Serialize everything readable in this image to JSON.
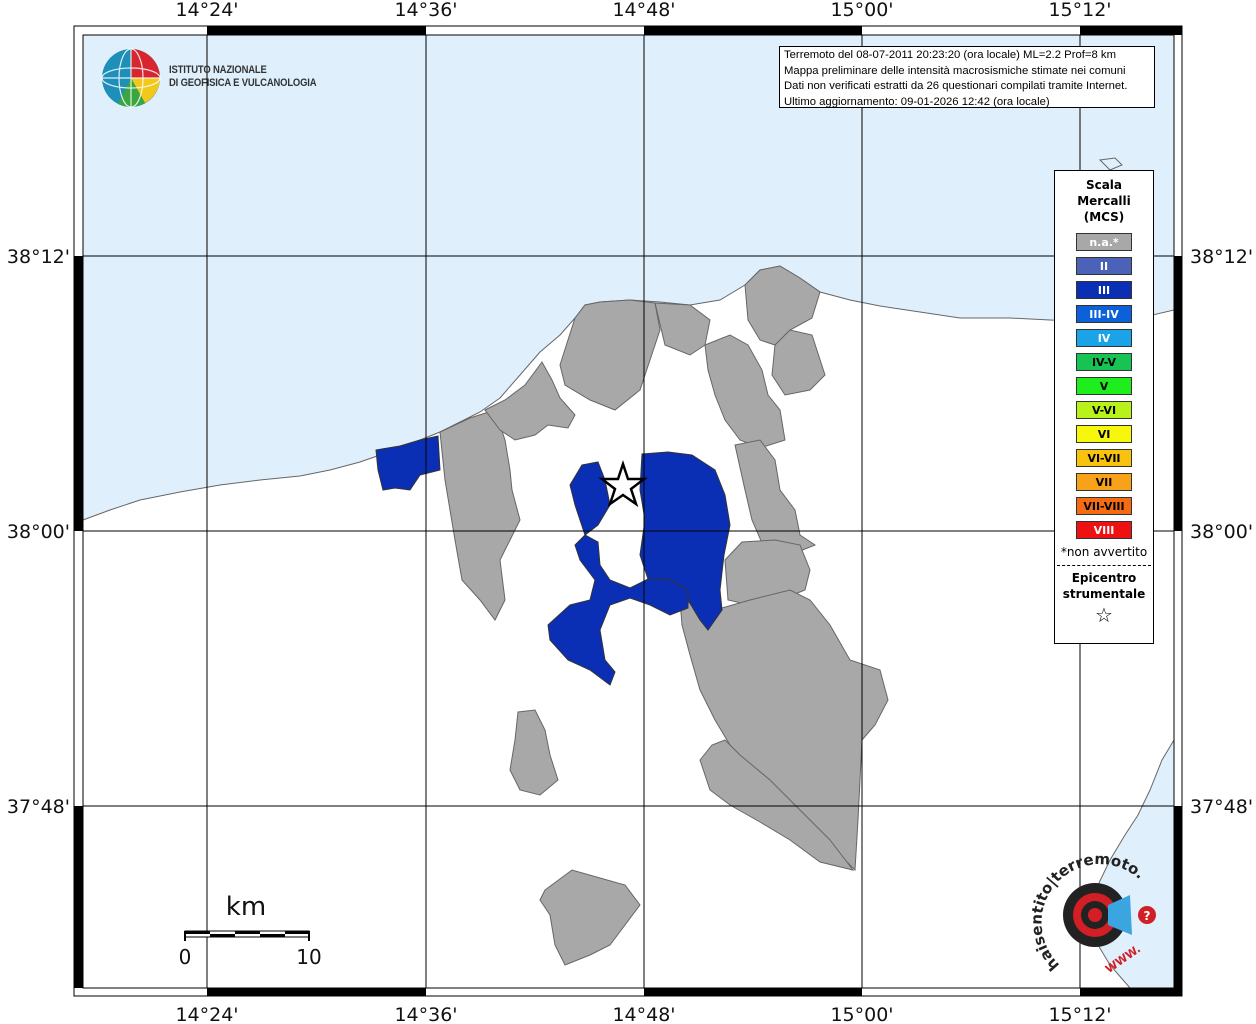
{
  "info": {
    "line1": "Terremoto del 08-07-2011 20:23:20 (ora locale) ML=2.2 Prof=8 km",
    "line2": "Mappa preliminare delle intensità macrosismiche stimate nei comuni",
    "line3": "Dati non verificati estratti da 26 questionari compilati tramite Internet.",
    "line4": "Ultimo aggiornamento: 09-01-2026 12:42 (ora locale)"
  },
  "logo": {
    "line1": "ISTITUTO NAZIONALE",
    "line2": "DI GEOFISICA E VULCANOLOGIA"
  },
  "axes": {
    "lon_labels": [
      "14°24'",
      "14°36'",
      "14°48'",
      "15°00'",
      "15°12'"
    ],
    "lat_labels": [
      "38°12'",
      "38°00'",
      "37°48'"
    ]
  },
  "scalebar": {
    "unit": "km",
    "start": "0",
    "end": "10"
  },
  "legend": {
    "title_line1": "Scala",
    "title_line2": "Mercalli",
    "title_line3": "(MCS)",
    "items": [
      {
        "label": "n.a.*",
        "color": "#a8a8a8",
        "text_color": "#ffffff"
      },
      {
        "label": "II",
        "color": "#4a63b8",
        "text_color": "#ffffff"
      },
      {
        "label": "III",
        "color": "#0a2fb5",
        "text_color": "#ffffff"
      },
      {
        "label": "III-IV",
        "color": "#0c60d8",
        "text_color": "#ffffff"
      },
      {
        "label": "IV",
        "color": "#1aa3e6",
        "text_color": "#ffffff"
      },
      {
        "label": "IV-V",
        "color": "#17c352",
        "text_color": "#000000"
      },
      {
        "label": "V",
        "color": "#1eee1e",
        "text_color": "#000000"
      },
      {
        "label": "V-VI",
        "color": "#b9f21a",
        "text_color": "#000000"
      },
      {
        "label": "VI",
        "color": "#f7f70d",
        "text_color": "#000000"
      },
      {
        "label": "VI-VII",
        "color": "#f8c20f",
        "text_color": "#000000"
      },
      {
        "label": "VII",
        "color": "#f8a21a",
        "text_color": "#000000"
      },
      {
        "label": "VII-VIII",
        "color": "#f46b12",
        "text_color": "#000000"
      },
      {
        "label": "VIII",
        "color": "#ee1111",
        "text_color": "#ffffff"
      }
    ],
    "note": "*non avvertito",
    "epi_line1": "Epicentro",
    "epi_line2": "strumentale",
    "epi_symbol": "☆"
  },
  "watermark": {
    "text": "haisentito|terremoto.it",
    "url_text": "WWW."
  },
  "colors": {
    "sea": "#dff0fc",
    "land": "#ffffff",
    "na": "#a8a8a8",
    "intensity_iii": "#0a2fb5"
  }
}
